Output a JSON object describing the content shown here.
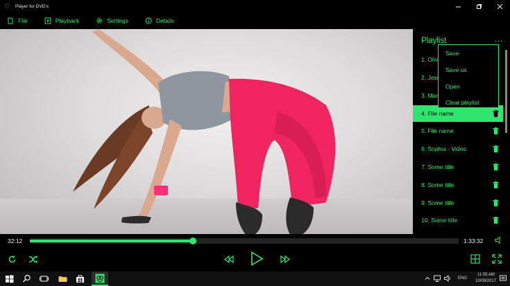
{
  "window": {
    "title": "Player for DVD's"
  },
  "menu": {
    "items": [
      "File",
      "Playback",
      "Settings",
      "Details"
    ]
  },
  "playlist": {
    "title": "Playlist",
    "more": "...",
    "items": [
      {
        "label": "1. Olivia"
      },
      {
        "label": "2. Jessica"
      },
      {
        "label": "3. Maria"
      },
      {
        "label": "4. File name"
      },
      {
        "label": "5. File name"
      },
      {
        "label": "6. Sophia - Video"
      },
      {
        "label": "7. Some title"
      },
      {
        "label": "8. Some title"
      },
      {
        "label": "9. Some title"
      },
      {
        "label": "10. Some title"
      }
    ],
    "active_index": 3
  },
  "context_menu": {
    "items": [
      "Save",
      "Save us",
      "Open",
      "Clear playlist"
    ]
  },
  "player": {
    "elapsed": "32:12",
    "total": "1:33:32",
    "progress": 0.38
  },
  "taskbar": {
    "language": "ENG",
    "time": "11:05 AM",
    "date": "10/09/2017"
  },
  "colors": {
    "accent": "#2fe56f",
    "background": "#000000"
  }
}
